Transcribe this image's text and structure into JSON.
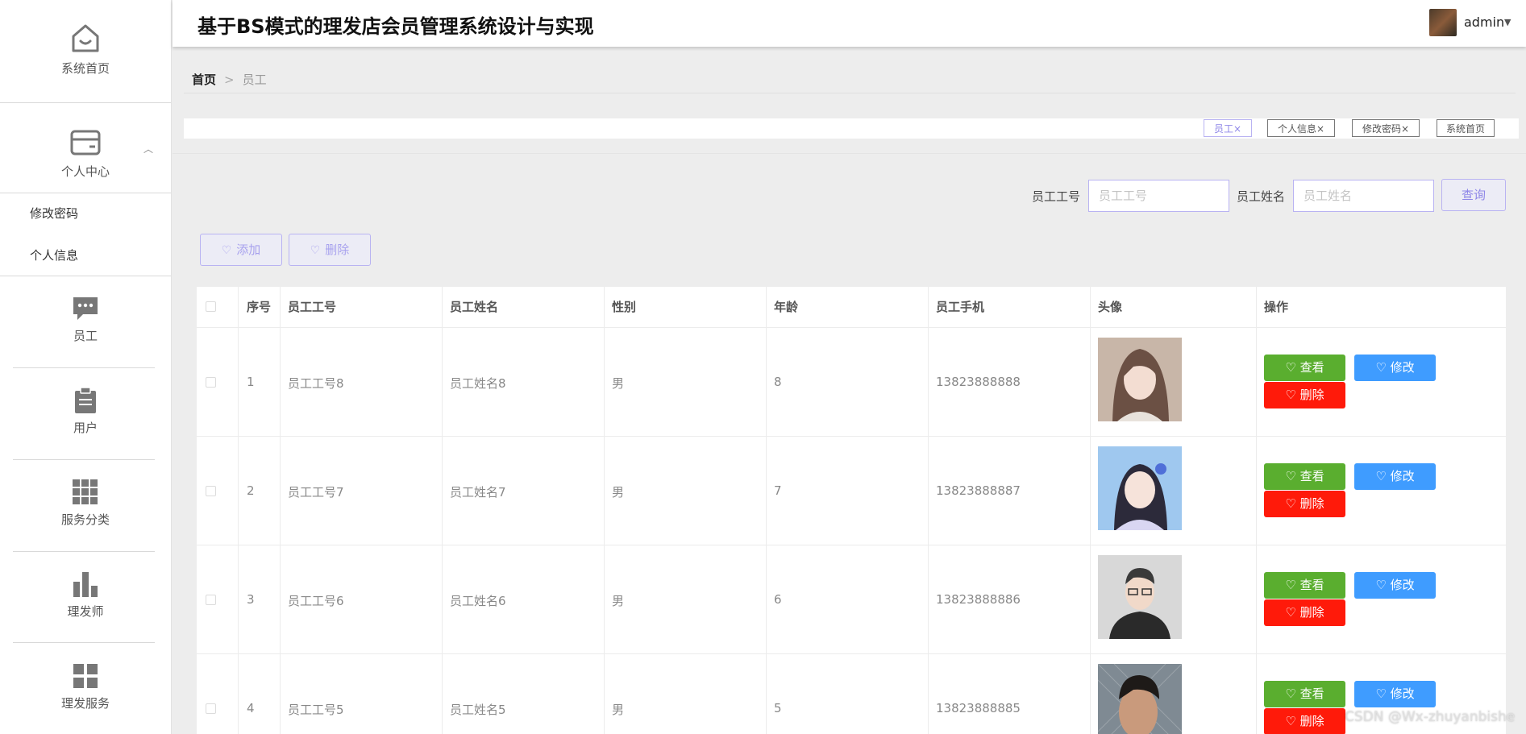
{
  "app": {
    "title": "基于BS模式的理发店会员管理系统设计与实现"
  },
  "user": {
    "name": "admin"
  },
  "sidebar": {
    "home": "系统首页",
    "personal_center": "个人中心",
    "sub_items": [
      "修改密码",
      "个人信息"
    ],
    "items": [
      "员工",
      "用户",
      "服务分类",
      "理发师",
      "理发服务"
    ]
  },
  "breadcrumb": {
    "home": "首页",
    "separator": ">",
    "current": "员工"
  },
  "tags": [
    "员工×",
    "个人信息×",
    "修改密码×",
    "系统首页"
  ],
  "search": {
    "id_label": "员工工号",
    "id_placeholder": "员工工号",
    "name_label": "员工姓名",
    "name_placeholder": "员工姓名",
    "query_button": "查询"
  },
  "toolbar": {
    "add": "添加",
    "delete": "删除"
  },
  "table": {
    "headers": [
      "序号",
      "员工工号",
      "员工姓名",
      "性别",
      "年龄",
      "员工手机",
      "头像",
      "操作"
    ],
    "rows": [
      {
        "index": "1",
        "emp_id": "员工工号8",
        "emp_name": "员工姓名8",
        "gender": "男",
        "age": "8",
        "phone": "13823888888"
      },
      {
        "index": "2",
        "emp_id": "员工工号7",
        "emp_name": "员工姓名7",
        "gender": "男",
        "age": "7",
        "phone": "13823888887"
      },
      {
        "index": "3",
        "emp_id": "员工工号6",
        "emp_name": "员工姓名6",
        "gender": "男",
        "age": "6",
        "phone": "13823888886"
      },
      {
        "index": "4",
        "emp_id": "员工工号5",
        "emp_name": "员工姓名5",
        "gender": "男",
        "age": "5",
        "phone": "13823888885"
      }
    ],
    "actions": {
      "view": "查看",
      "edit": "修改",
      "delete": "删除"
    }
  },
  "watermark": "CSDN @Wx-zhuyanbishe",
  "colors": {
    "accent": "#8f87e8",
    "view_button": "#5aae2f",
    "edit_button": "#3f9cff",
    "delete_button": "#ff1a0a",
    "icon_gray": "#777777"
  },
  "icons": [
    "home-icon",
    "card-icon",
    "chat-icon",
    "clipboard-icon",
    "grid-icon",
    "bar-chart-icon",
    "tiles-icon",
    "heart-icon"
  ]
}
